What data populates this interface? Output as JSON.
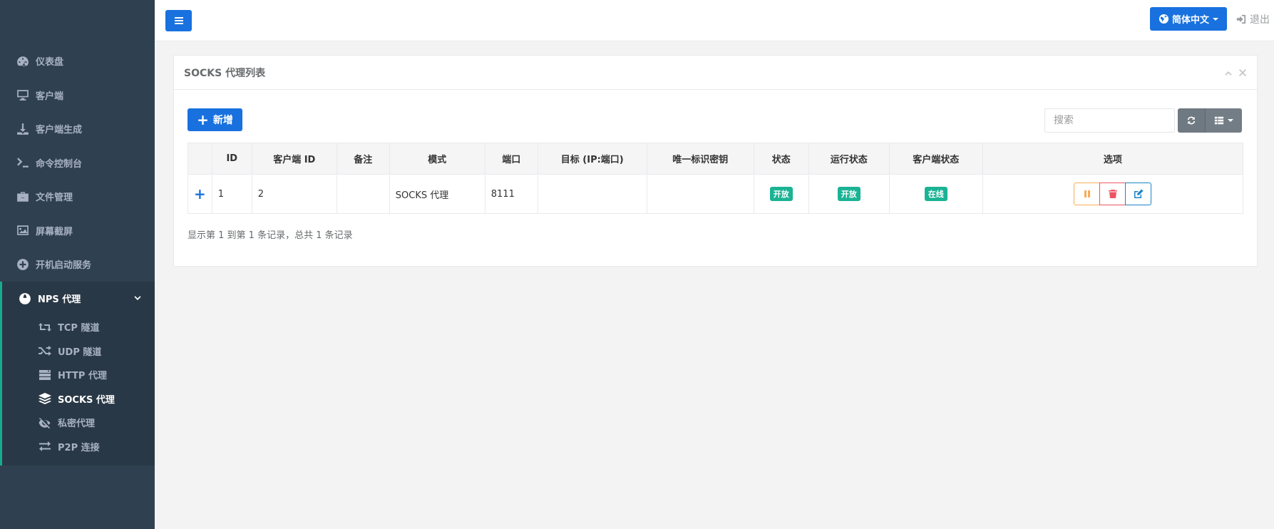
{
  "sidebar": {
    "items": [
      {
        "label": "仪表盘",
        "icon": "dashboard-icon"
      },
      {
        "label": "客户端",
        "icon": "monitor-icon"
      },
      {
        "label": "客户端生成",
        "icon": "download-icon"
      },
      {
        "label": "命令控制台",
        "icon": "terminal-icon"
      },
      {
        "label": "文件管理",
        "icon": "briefcase-icon"
      },
      {
        "label": "屏幕截屏",
        "icon": "image-icon"
      },
      {
        "label": "开机启动服务",
        "icon": "plus-circle-icon"
      }
    ],
    "group": {
      "label": "NPS 代理",
      "icon": "globe-icon",
      "children": [
        {
          "label": "TCP 隧道",
          "icon": "retweet-icon"
        },
        {
          "label": "UDP 隧道",
          "icon": "random-icon"
        },
        {
          "label": "HTTP 代理",
          "icon": "server-icon"
        },
        {
          "label": "SOCKS 代理",
          "icon": "layers-icon",
          "active": true
        },
        {
          "label": "私密代理",
          "icon": "eye-slash-icon"
        },
        {
          "label": "P2P 连接",
          "icon": "exchange-icon"
        }
      ]
    }
  },
  "topbar": {
    "language": "简体中文",
    "logout": "退出"
  },
  "panel": {
    "title": "SOCKS 代理列表",
    "add_label": "新增",
    "search_placeholder": "搜索",
    "columns": [
      "ID",
      "客户端 ID",
      "备注",
      "模式",
      "端口",
      "目标 (IP:端口)",
      "唯一标识密钥",
      "状态",
      "运行状态",
      "客户端状态",
      "选项"
    ],
    "rows": [
      {
        "expand": "+",
        "id": "1",
        "client_id": "2",
        "remark": "",
        "mode": "SOCKS 代理",
        "port": "8111",
        "target": "",
        "key": "",
        "status": "开放",
        "run_status": "开放",
        "client_status": "在线"
      }
    ],
    "footer": "显示第 1 到第 1 条记录，总共 1 条记录"
  },
  "colors": {
    "sidebar_bg": "#2f4050",
    "sidebar_active_bg": "#293846",
    "primary": "#1871de",
    "badge": "#1ab394",
    "warning": "#f8ac59",
    "danger": "#ed5565",
    "info": "#1c84c6"
  }
}
